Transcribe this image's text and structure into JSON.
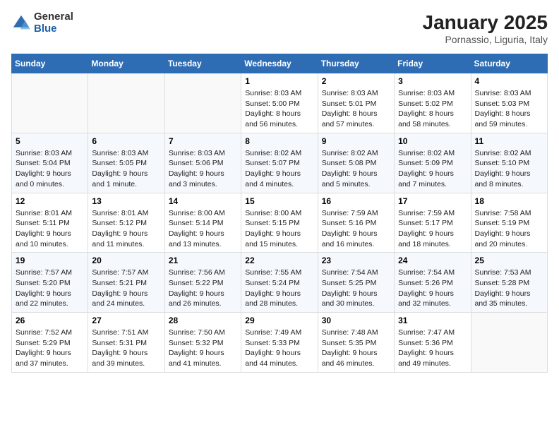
{
  "logo": {
    "general": "General",
    "blue": "Blue"
  },
  "title": "January 2025",
  "subtitle": "Pornassio, Liguria, Italy",
  "days_header": [
    "Sunday",
    "Monday",
    "Tuesday",
    "Wednesday",
    "Thursday",
    "Friday",
    "Saturday"
  ],
  "weeks": [
    [
      {
        "day": "",
        "info": ""
      },
      {
        "day": "",
        "info": ""
      },
      {
        "day": "",
        "info": ""
      },
      {
        "day": "1",
        "info": "Sunrise: 8:03 AM\nSunset: 5:00 PM\nDaylight: 8 hours\nand 56 minutes."
      },
      {
        "day": "2",
        "info": "Sunrise: 8:03 AM\nSunset: 5:01 PM\nDaylight: 8 hours\nand 57 minutes."
      },
      {
        "day": "3",
        "info": "Sunrise: 8:03 AM\nSunset: 5:02 PM\nDaylight: 8 hours\nand 58 minutes."
      },
      {
        "day": "4",
        "info": "Sunrise: 8:03 AM\nSunset: 5:03 PM\nDaylight: 8 hours\nand 59 minutes."
      }
    ],
    [
      {
        "day": "5",
        "info": "Sunrise: 8:03 AM\nSunset: 5:04 PM\nDaylight: 9 hours\nand 0 minutes."
      },
      {
        "day": "6",
        "info": "Sunrise: 8:03 AM\nSunset: 5:05 PM\nDaylight: 9 hours\nand 1 minute."
      },
      {
        "day": "7",
        "info": "Sunrise: 8:03 AM\nSunset: 5:06 PM\nDaylight: 9 hours\nand 3 minutes."
      },
      {
        "day": "8",
        "info": "Sunrise: 8:02 AM\nSunset: 5:07 PM\nDaylight: 9 hours\nand 4 minutes."
      },
      {
        "day": "9",
        "info": "Sunrise: 8:02 AM\nSunset: 5:08 PM\nDaylight: 9 hours\nand 5 minutes."
      },
      {
        "day": "10",
        "info": "Sunrise: 8:02 AM\nSunset: 5:09 PM\nDaylight: 9 hours\nand 7 minutes."
      },
      {
        "day": "11",
        "info": "Sunrise: 8:02 AM\nSunset: 5:10 PM\nDaylight: 9 hours\nand 8 minutes."
      }
    ],
    [
      {
        "day": "12",
        "info": "Sunrise: 8:01 AM\nSunset: 5:11 PM\nDaylight: 9 hours\nand 10 minutes."
      },
      {
        "day": "13",
        "info": "Sunrise: 8:01 AM\nSunset: 5:12 PM\nDaylight: 9 hours\nand 11 minutes."
      },
      {
        "day": "14",
        "info": "Sunrise: 8:00 AM\nSunset: 5:14 PM\nDaylight: 9 hours\nand 13 minutes."
      },
      {
        "day": "15",
        "info": "Sunrise: 8:00 AM\nSunset: 5:15 PM\nDaylight: 9 hours\nand 15 minutes."
      },
      {
        "day": "16",
        "info": "Sunrise: 7:59 AM\nSunset: 5:16 PM\nDaylight: 9 hours\nand 16 minutes."
      },
      {
        "day": "17",
        "info": "Sunrise: 7:59 AM\nSunset: 5:17 PM\nDaylight: 9 hours\nand 18 minutes."
      },
      {
        "day": "18",
        "info": "Sunrise: 7:58 AM\nSunset: 5:19 PM\nDaylight: 9 hours\nand 20 minutes."
      }
    ],
    [
      {
        "day": "19",
        "info": "Sunrise: 7:57 AM\nSunset: 5:20 PM\nDaylight: 9 hours\nand 22 minutes."
      },
      {
        "day": "20",
        "info": "Sunrise: 7:57 AM\nSunset: 5:21 PM\nDaylight: 9 hours\nand 24 minutes."
      },
      {
        "day": "21",
        "info": "Sunrise: 7:56 AM\nSunset: 5:22 PM\nDaylight: 9 hours\nand 26 minutes."
      },
      {
        "day": "22",
        "info": "Sunrise: 7:55 AM\nSunset: 5:24 PM\nDaylight: 9 hours\nand 28 minutes."
      },
      {
        "day": "23",
        "info": "Sunrise: 7:54 AM\nSunset: 5:25 PM\nDaylight: 9 hours\nand 30 minutes."
      },
      {
        "day": "24",
        "info": "Sunrise: 7:54 AM\nSunset: 5:26 PM\nDaylight: 9 hours\nand 32 minutes."
      },
      {
        "day": "25",
        "info": "Sunrise: 7:53 AM\nSunset: 5:28 PM\nDaylight: 9 hours\nand 35 minutes."
      }
    ],
    [
      {
        "day": "26",
        "info": "Sunrise: 7:52 AM\nSunset: 5:29 PM\nDaylight: 9 hours\nand 37 minutes."
      },
      {
        "day": "27",
        "info": "Sunrise: 7:51 AM\nSunset: 5:31 PM\nDaylight: 9 hours\nand 39 minutes."
      },
      {
        "day": "28",
        "info": "Sunrise: 7:50 AM\nSunset: 5:32 PM\nDaylight: 9 hours\nand 41 minutes."
      },
      {
        "day": "29",
        "info": "Sunrise: 7:49 AM\nSunset: 5:33 PM\nDaylight: 9 hours\nand 44 minutes."
      },
      {
        "day": "30",
        "info": "Sunrise: 7:48 AM\nSunset: 5:35 PM\nDaylight: 9 hours\nand 46 minutes."
      },
      {
        "day": "31",
        "info": "Sunrise: 7:47 AM\nSunset: 5:36 PM\nDaylight: 9 hours\nand 49 minutes."
      },
      {
        "day": "",
        "info": ""
      }
    ]
  ]
}
